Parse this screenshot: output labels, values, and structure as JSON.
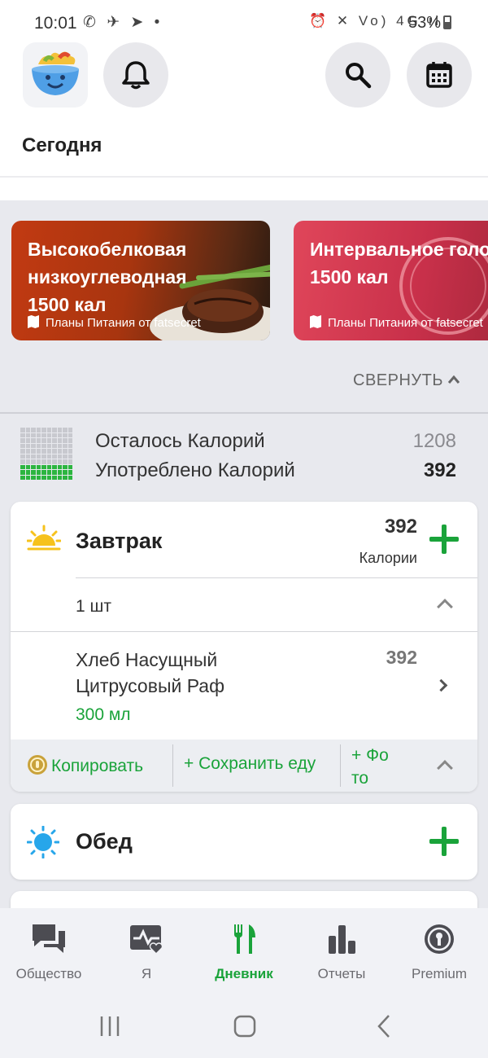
{
  "status_bar": {
    "time": "10:01",
    "left_icons": "✆ ✈ ➤ •",
    "right_icons": "⏰ ✕ Vo) 4G ıl",
    "battery": "53%"
  },
  "header": {
    "title": "Сегодня"
  },
  "banners": [
    {
      "title_lines": [
        "Высокобелковая",
        "низкоуглеводная",
        "1500 кал"
      ],
      "subtitle": "Планы Питания от fatsecret"
    },
    {
      "title_lines": [
        "Интервальное голодание",
        "1500 кал"
      ],
      "subtitle": "Планы Питания от fatsecret"
    }
  ],
  "collapse_label": "СВЕРНУТЬ",
  "calories": {
    "remaining_label": "Осталось Калорий",
    "remaining_value": "1208",
    "consumed_label": "Употреблено Калорий",
    "consumed_value": "392"
  },
  "breakfast": {
    "title": "Завтрак",
    "calories": "392",
    "calories_label": "Калории",
    "portion_label": "1 шт",
    "item": {
      "name_line1": "Хлеб Насущный",
      "name_line2": "Цитрусовый Раф",
      "amount": "300 мл",
      "calories": "392"
    },
    "actions": {
      "copy": "Копировать",
      "save": "+ Сохранить еду",
      "photo_line1": "+ Фо",
      "photo_line2": "то"
    }
  },
  "lunch": {
    "title": "Обед"
  },
  "bottom_nav": [
    {
      "label": "Общество",
      "icon": "chat-bubbles-icon",
      "active": false
    },
    {
      "label": "Я",
      "icon": "health-icon",
      "active": false
    },
    {
      "label": "Дневник",
      "icon": "fork-knife-icon",
      "active": true
    },
    {
      "label": "Отчеты",
      "icon": "bar-chart-icon",
      "active": false
    },
    {
      "label": "Premium",
      "icon": "premium-badge-icon",
      "active": false
    }
  ],
  "colors": {
    "accent_green": "#1aa33a",
    "banner1": "#c23a12",
    "banner2": "#e0465a",
    "background": "#e8e9ee"
  }
}
